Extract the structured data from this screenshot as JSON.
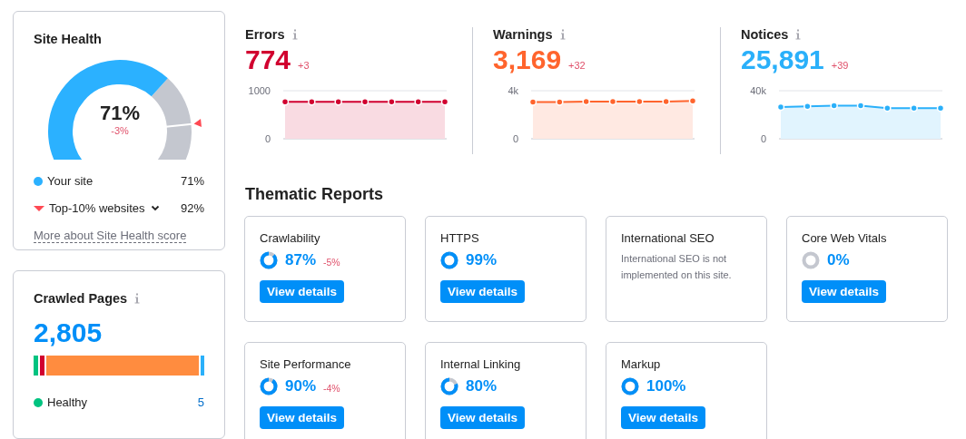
{
  "site_health": {
    "title": "Site Health",
    "value": "71%",
    "change": "-3%",
    "legend": [
      {
        "kind": "dot",
        "label": "Your site",
        "value": "71%"
      },
      {
        "kind": "marker",
        "label": "Top-10% websites",
        "value": "92%"
      }
    ],
    "link": "More about Site Health score"
  },
  "crawled_pages": {
    "title": "Crawled Pages",
    "value": "2,805",
    "bar": [
      {
        "color": "#00c380"
      },
      {
        "color": "#d1002f"
      },
      {
        "color": "#ff8c3f"
      },
      {
        "color": "#2ab0fa"
      }
    ],
    "legend": [
      {
        "color": "#00c380",
        "label": "Healthy",
        "value": "5"
      }
    ]
  },
  "metrics": [
    {
      "title": "Errors",
      "value": "774",
      "change": "+3",
      "color": "#d1002f",
      "chart_data": {
        "type": "area",
        "ylim": [
          0,
          1000
        ],
        "yticks": [
          {
            "value": 0,
            "label": "0"
          },
          {
            "value": 1000,
            "label": "1000"
          }
        ],
        "series": [
          {
            "color": "#d1002f",
            "values": [
              770,
              770,
              770,
              770,
              770,
              770,
              770
            ]
          }
        ]
      }
    },
    {
      "title": "Warnings",
      "value": "3,169",
      "change": "+32",
      "color": "#ff642d",
      "chart_data": {
        "type": "area",
        "ylim": [
          0,
          4000
        ],
        "yticks": [
          {
            "value": 0,
            "label": "0"
          },
          {
            "value": 4000,
            "label": "4k"
          }
        ],
        "series": [
          {
            "color": "#ff642d",
            "values": [
              3050,
              3050,
              3100,
              3100,
              3100,
              3100,
              3150
            ]
          }
        ]
      }
    },
    {
      "title": "Notices",
      "value": "25,891",
      "change": "+39",
      "color": "#2ab0fa",
      "chart_data": {
        "type": "area",
        "ylim": [
          0,
          40000
        ],
        "yticks": [
          {
            "value": 0,
            "label": "0"
          },
          {
            "value": 40000,
            "label": "40k"
          }
        ],
        "series": [
          {
            "color": "#2ab0fa",
            "values": [
              26500,
              27000,
              27500,
              27500,
              25500,
              25500,
              25500
            ]
          }
        ]
      }
    }
  ],
  "thematic_reports": {
    "title": "Thematic Reports",
    "cards": [
      {
        "kind": "score",
        "title": "Crawlability",
        "value": "87%",
        "change": "-5%",
        "button": "View details"
      },
      {
        "kind": "score",
        "title": "HTTPS",
        "value": "99%",
        "button": "View details"
      },
      {
        "kind": "message",
        "title": "International SEO",
        "message": "International SEO is not implemented on this site."
      },
      {
        "kind": "score",
        "title": "Core Web Vitals",
        "value": "0%",
        "button": "View details"
      },
      {
        "kind": "score",
        "title": "Site Performance",
        "value": "90%",
        "change": "-4%",
        "button": "View details"
      },
      {
        "kind": "score",
        "title": "Internal Linking",
        "value": "80%",
        "button": "View details"
      },
      {
        "kind": "score",
        "title": "Markup",
        "value": "100%",
        "button": "View details"
      }
    ]
  }
}
